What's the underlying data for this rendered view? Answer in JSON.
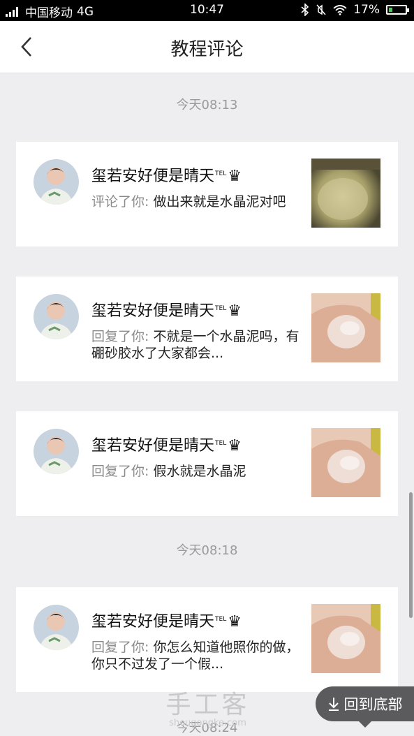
{
  "status_bar": {
    "carrier": "中国移动",
    "network": "4G",
    "time": "10:47",
    "battery": "17%",
    "icons": [
      "signal-icon",
      "bluetooth-icon",
      "mute-icon",
      "wifi-icon",
      "battery-icon"
    ]
  },
  "header": {
    "title": "教程评论",
    "back_icon": "chevron-left-icon"
  },
  "feed": [
    {
      "type": "time",
      "label": "今天08:13"
    },
    {
      "type": "comment",
      "user": "玺若安好便是晴天",
      "tel": "TEL",
      "crown": "♛",
      "prefix": "评论了你:",
      "text": "做出来就是水晶泥对吧",
      "thumb": "crystal-slime-photo-1"
    },
    {
      "type": "comment",
      "user": "玺若安好便是晴天",
      "tel": "TEL",
      "crown": "♛",
      "prefix": "回复了你:",
      "text": "不就是一个水晶泥吗，有硼砂胶水了大家都会...",
      "thumb": "crystal-slime-hand-photo"
    },
    {
      "type": "comment",
      "user": "玺若安好便是晴天",
      "tel": "TEL",
      "crown": "♛",
      "prefix": "回复了你:",
      "text": "假水就是水晶泥",
      "thumb": "crystal-slime-hand-photo"
    },
    {
      "type": "time",
      "label": "今天08:18"
    },
    {
      "type": "comment",
      "user": "玺若安好便是晴天",
      "tel": "TEL",
      "crown": "♛",
      "prefix": "回复了你:",
      "text": "你怎么知道他照你的做，你只不过发了一个假...",
      "thumb": "crystal-slime-hand-photo"
    },
    {
      "type": "time",
      "label": "今天08:24"
    }
  ],
  "watermark": {
    "text": "手工客",
    "url": "shougongke.com"
  },
  "float_button": {
    "label": "回到底部",
    "icon": "arrow-down-icon"
  },
  "colors": {
    "background": "#eeeef0",
    "card": "#ffffff",
    "muted_text": "#9a9a9c",
    "float_button_bg": "#5b5b5e"
  }
}
